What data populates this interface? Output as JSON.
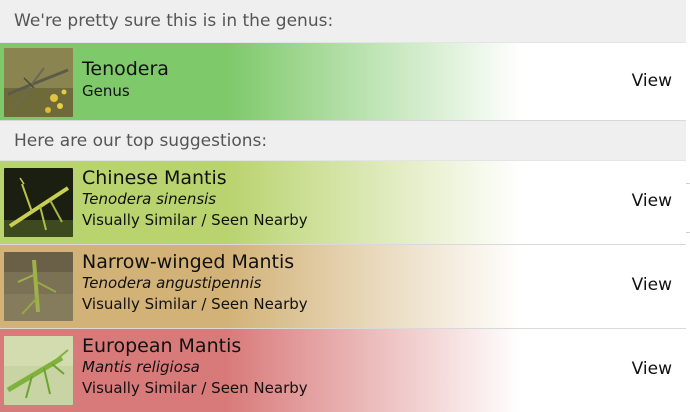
{
  "genus_section": {
    "header": "We're pretty sure this is in the genus:",
    "item": {
      "name": "Tenodera",
      "rank": "Genus",
      "view_label": "View",
      "color": "#7ec96a"
    }
  },
  "suggestions_section": {
    "header": "Here are our top suggestions:",
    "items": [
      {
        "name": "Chinese Mantis",
        "scientific_name": "Tenodera sinensis",
        "reason": "Visually Similar / Seen Nearby",
        "view_label": "View",
        "color": "#b9d36e"
      },
      {
        "name": "Narrow-winged Mantis",
        "scientific_name": "Tenodera angustipennis",
        "reason": "Visually Similar / Seen Nearby",
        "view_label": "View",
        "color": "#d2b277"
      },
      {
        "name": "European Mantis",
        "scientific_name": "Mantis religiosa",
        "reason": "Visually Similar / Seen Nearby",
        "view_label": "View",
        "color": "#d97a7a"
      }
    ]
  }
}
